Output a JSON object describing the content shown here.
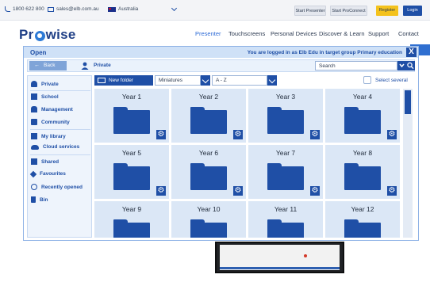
{
  "topbar": {
    "phone": "1800 622 800",
    "email": "sales@elb.com.au",
    "country": "Australia",
    "btn_presenter": "Start Presenter",
    "btn_proconnect": "Start ProConnect",
    "btn_register": "Register",
    "btn_login": "Login"
  },
  "header": {
    "logo_pre": "Pr",
    "logo_post": "wise",
    "nav": [
      "Presenter",
      "Touchscreens",
      "Personal Devices",
      "Discover & Learn",
      "Support",
      "Contact"
    ]
  },
  "modal": {
    "title": "Open",
    "logged_in": "You are logged in as Elb Edu in target group Primary education",
    "close": "X",
    "back": "Back",
    "crumb": "Private",
    "search_value": "Search",
    "sidebar": [
      "Private",
      "School",
      "Management",
      "Community",
      "My library",
      "Cloud services",
      "Shared",
      "Favourites",
      "Recently opened",
      "Bin"
    ],
    "new_folder": "New folder",
    "view_mode": "Miniatures",
    "sort": "A - Z",
    "select_several": "Select several",
    "folders": [
      "Year 1",
      "Year 2",
      "Year 3",
      "Year 4",
      "Year 5",
      "Year 6",
      "Year 7",
      "Year 8",
      "Year 9",
      "Year 10",
      "Year 11",
      "Year 12"
    ]
  },
  "colors": {
    "primary": "#1f4fa6",
    "tile_bg": "#dbe7f6",
    "header_bg": "#cfe1f7",
    "register": "#f4c21c"
  }
}
